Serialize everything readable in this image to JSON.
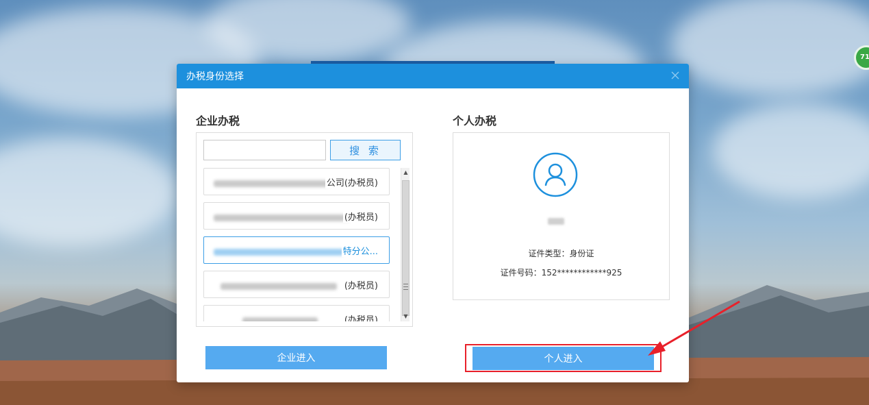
{
  "dialog": {
    "title": "办税身份选择",
    "close_label": "×"
  },
  "enterprise": {
    "title": "企业办税",
    "search": {
      "value": "",
      "placeholder": "",
      "button_label": "搜 索"
    },
    "items": [
      {
        "visible_text": "公司(办税员)",
        "selected": false
      },
      {
        "visible_text": "(办税员)",
        "selected": false
      },
      {
        "visible_text": "特分公...",
        "selected": true
      },
      {
        "visible_text": "(办税员)",
        "selected": false
      },
      {
        "visible_text": "(办税员)",
        "selected": false
      }
    ],
    "scroll": {
      "up_glyph": "▲",
      "down_glyph": "▼"
    },
    "enter_button": "企业进入"
  },
  "personal": {
    "title": "个人办税",
    "cert_type_label": "证件类型：",
    "cert_type_value": "身份证",
    "cert_number_label": "证件号码：",
    "cert_number_value": "152************925",
    "enter_button": "个人进入"
  },
  "side_badge": {
    "text": "71"
  },
  "colors": {
    "header_blue": "#1d90dd",
    "button_blue": "#55aaf0",
    "highlight_red": "#e8202a",
    "badge_green": "#3aa845"
  }
}
